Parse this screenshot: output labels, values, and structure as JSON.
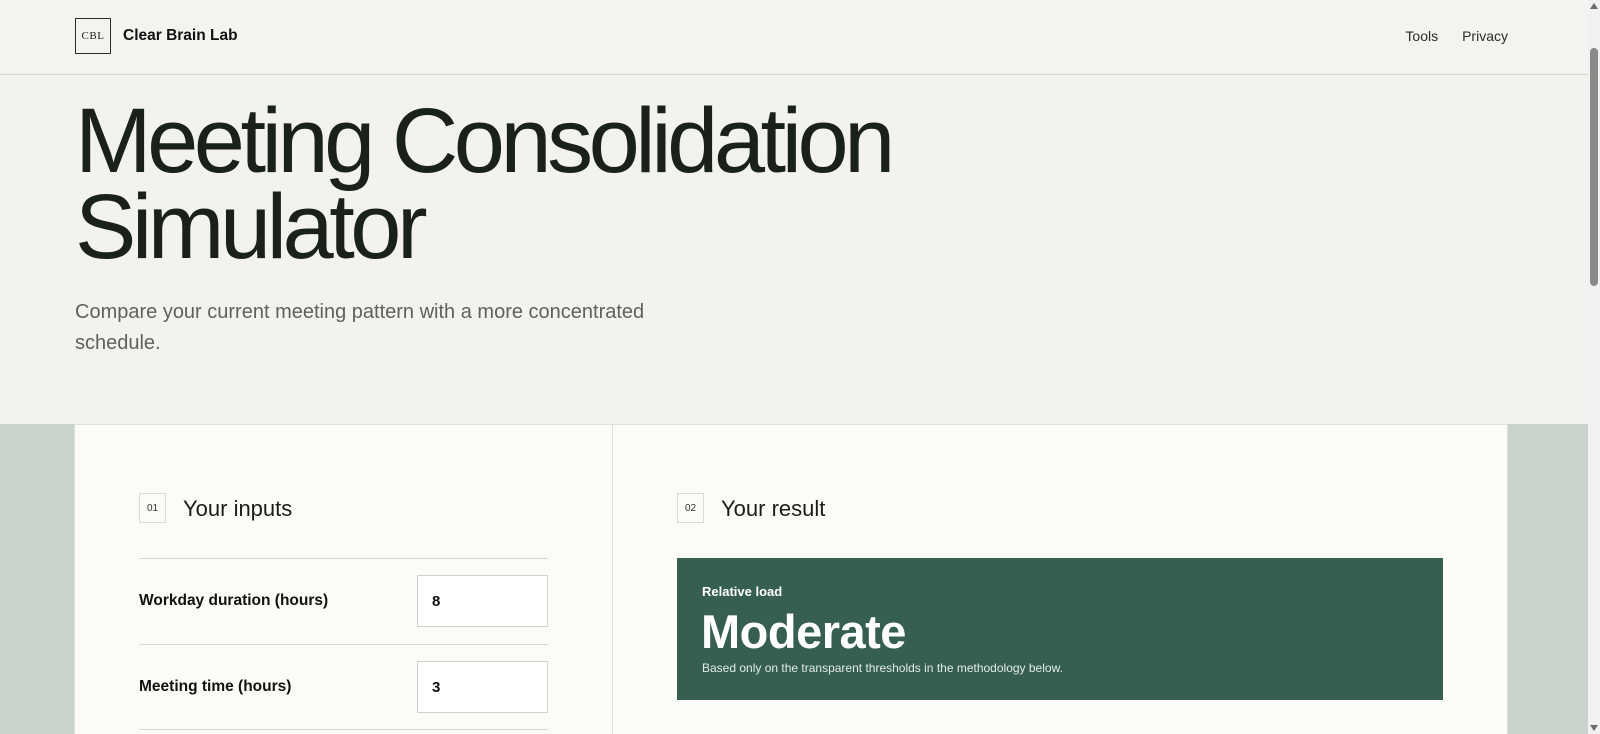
{
  "header": {
    "logo_text": "CBL",
    "brand": "Clear Brain Lab",
    "nav": [
      "Tools",
      "Privacy"
    ]
  },
  "hero": {
    "title_line1": "Meeting Consolidation",
    "title_line2": "Simulator",
    "subtitle": "Compare your current meeting pattern with a more concentrated schedule."
  },
  "inputs": {
    "step": "01",
    "title": "Your inputs",
    "fields": [
      {
        "label": "Workday duration (hours)",
        "value": "8"
      },
      {
        "label": "Meeting time (hours)",
        "value": "3"
      }
    ]
  },
  "result": {
    "step": "02",
    "title": "Your result",
    "kicker": "Relative load",
    "value": "Moderate",
    "note": "Based only on the transparent thresholds in the methodology below."
  },
  "colors": {
    "page_bg": "#f2f2ee",
    "band_bg": "#c9d3cc",
    "result_bg": "#365e51"
  }
}
